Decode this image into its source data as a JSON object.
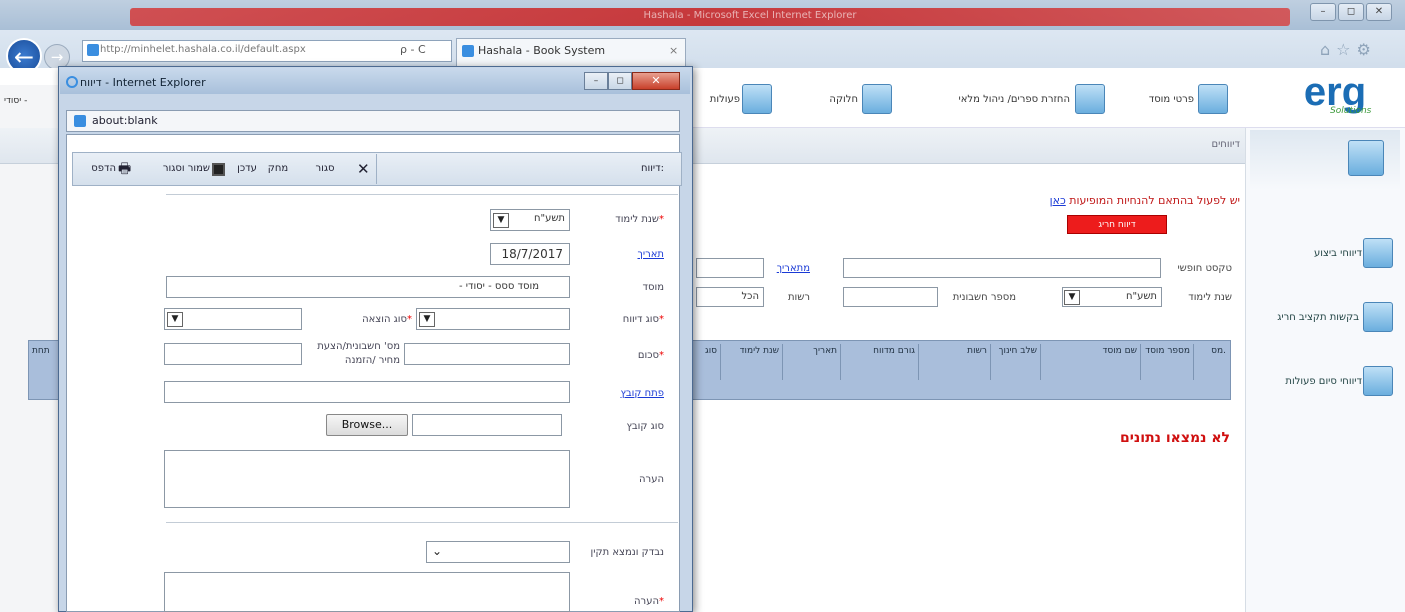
{
  "browser": {
    "window_title": "Hashala - Microsoft Excel Internet Explorer",
    "url": "http://minhelet.hashala.co.il/default.aspx",
    "search_hint": "ρ - C",
    "tab_label": "Hashala - Book System",
    "tab_close": "×",
    "window_buttons": [
      "–",
      "◻",
      "✕"
    ]
  },
  "app": {
    "logo": "erg",
    "logo_sub": "Solutions",
    "top_menu": [
      "פרטי מוסד",
      "החזרת ספרים/ ניהול מלאי",
      "חלוקה",
      "פעולות"
    ],
    "breadcrumb": "דיווחים",
    "left_cut": "יסודי - ",
    "side_menu": [
      "דיווחי ביצוע",
      "בקשות תקציב חריג",
      "דיווחי סיום פעולות"
    ],
    "warning": "יש לפעול בהתאם להנחיות המופיעות ",
    "warning_link": "כאן",
    "red_button": "דיווח חריג",
    "filters": {
      "free_text": "טקסט חופשי",
      "from_date": "מתאריך",
      "school_year": "שנת לימוד",
      "school_year_value": "תשע\"ח",
      "invoice_no": "מספר חשבונית",
      "authority": "רשות",
      "authority_value": "הכל"
    },
    "grid_headers": [
      "מס.",
      "מספר מוסד",
      "שם מוסד",
      "שלב חינוך",
      "רשות",
      "גורם מדווח",
      "תאריך",
      "שנת לימוד",
      "סוג"
    ],
    "no_data": "לא נמצאו נתונים",
    "left_grid_header": "תחת"
  },
  "popup": {
    "title": "דיווח - Internet Explorer",
    "address": "about:blank",
    "toolbar": {
      "print": "הדפס",
      "save_close": "שמור וסגור",
      "edit": "עדכן",
      "delete": "מחק",
      "close": "סגור",
      "report": "דיווח:"
    },
    "form": {
      "year_label": "שנת לימוד",
      "year_value": "תשע\"ח",
      "date_label": "תאריך",
      "date_value": "18/7/2017",
      "institution_label": "מוסד",
      "institution_value": "- מוסד ססס - יסודי",
      "report_type_label": "סוג דיווח",
      "expense_type_label": "סוג הוצאה",
      "amount_label": "סכום",
      "invoice_label": "מס' חשבונית/הצעת מחיר /הזמנה",
      "open_file_link": "פתח קובץ",
      "attach_label": "סוג קובץ",
      "browse": "Browse...",
      "note_label": "הערה",
      "checked_label": "נבדק ונמצא תקין",
      "note2_label": "הערה"
    }
  }
}
